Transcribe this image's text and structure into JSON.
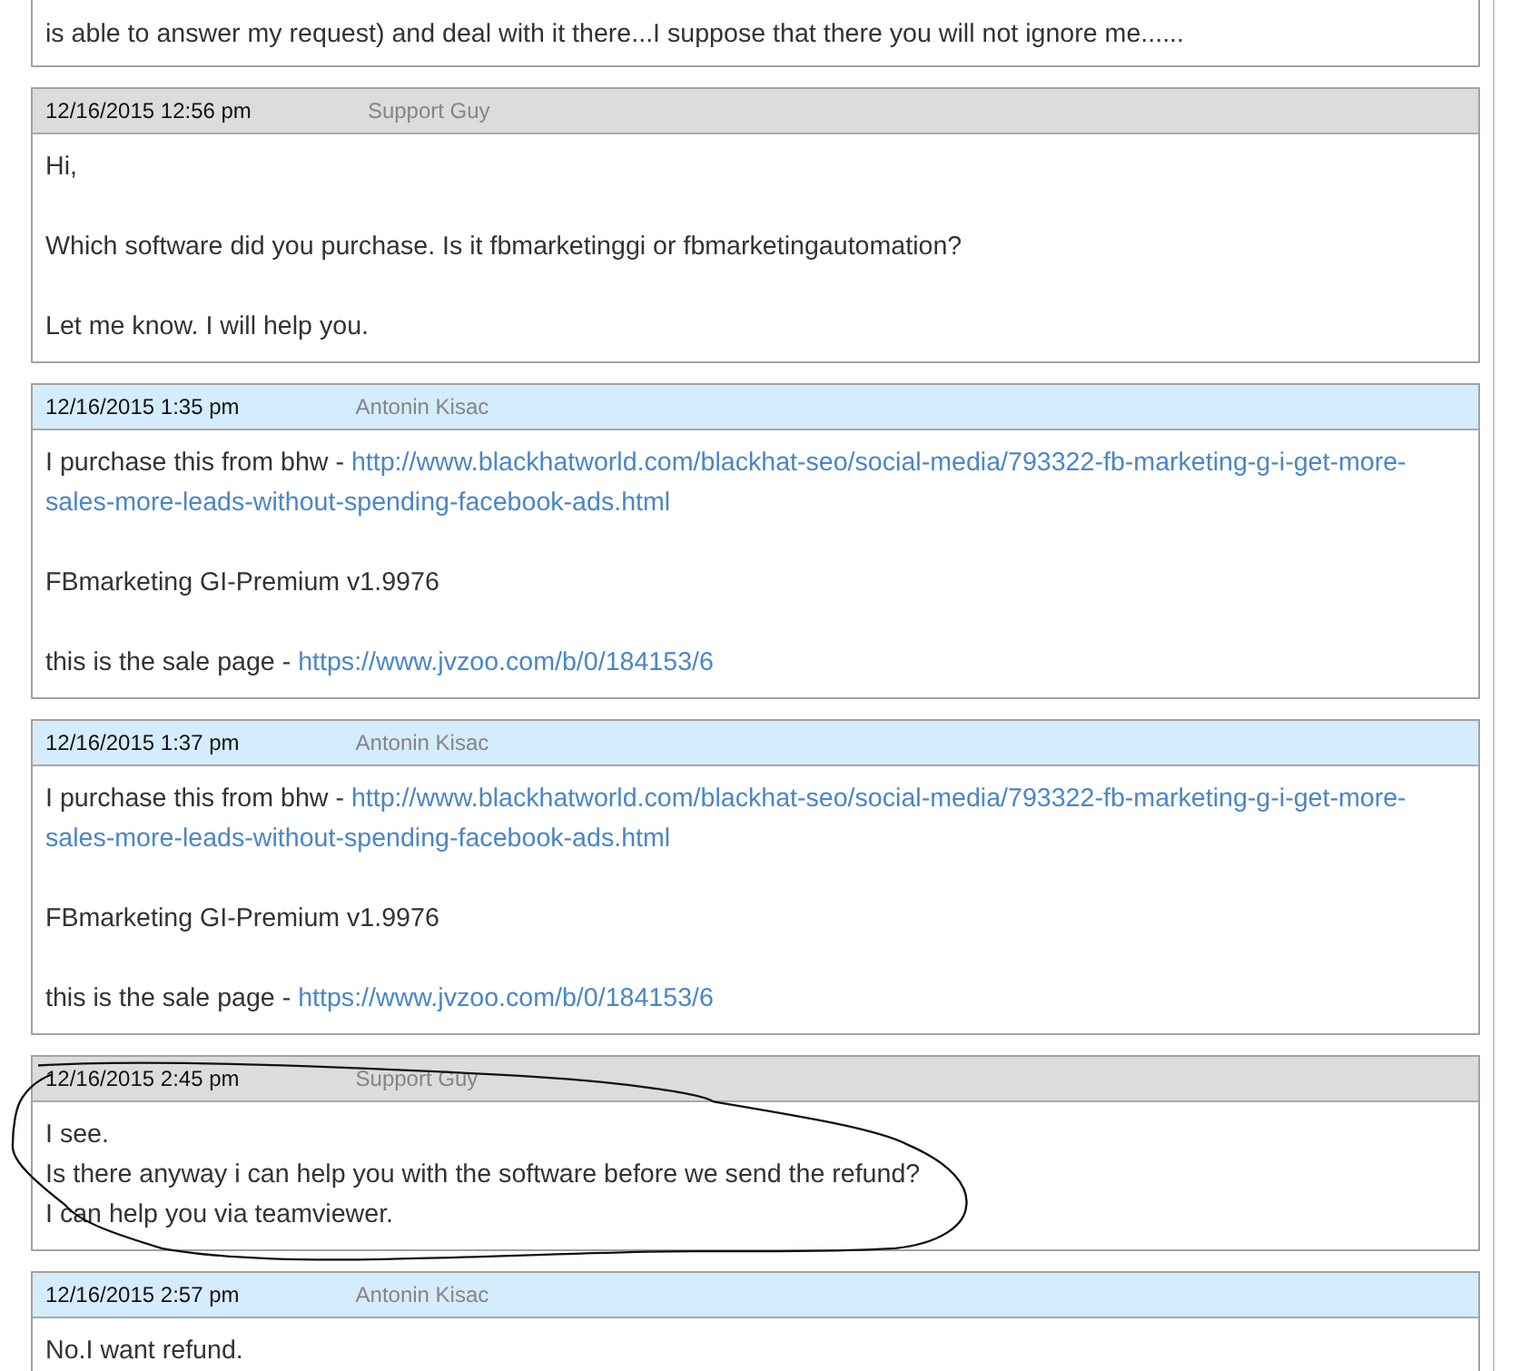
{
  "messages": [
    {
      "circled": false,
      "paragraphs": [
        {
          "lines": [
            {
              "text": "is able to answer my request) and deal with it there...I suppose that there you will not ignore me......"
            }
          ]
        }
      ]
    },
    {
      "kind": "staff",
      "date": "12/16/2015 12:56 pm",
      "author": "Support Guy",
      "circled": false,
      "paragraphs": [
        {
          "lines": [
            {
              "text": "Hi,"
            }
          ]
        },
        {
          "lines": [
            {
              "text": "Which software did you purchase. Is it fbmarketinggi or fbmarketingautomation?"
            }
          ]
        },
        {
          "lines": [
            {
              "text": "Let me know. I will help you."
            }
          ]
        }
      ]
    },
    {
      "kind": "customer",
      "date": "12/16/2015 1:35 pm",
      "author": "Antonin Kisac",
      "circled": false,
      "paragraphs": [
        {
          "lines": [
            {
              "text": "I purchase this from bhw - ",
              "link": "http://www.blackhatworld.com/blackhat-seo/social-media/793322-fb-marketing-g-i-get-more-"
            },
            {
              "link": "sales-more-leads-without-spending-facebook-ads.html"
            }
          ]
        },
        {
          "lines": [
            {
              "text": "FBmarketing GI-Premium v1.9976"
            }
          ]
        },
        {
          "lines": [
            {
              "text": "this is the sale page - ",
              "link": "https://www.jvzoo.com/b/0/184153/6"
            }
          ]
        }
      ]
    },
    {
      "kind": "customer",
      "date": "12/16/2015 1:37 pm",
      "author": "Antonin Kisac",
      "circled": false,
      "paragraphs": [
        {
          "lines": [
            {
              "text": "I purchase this from bhw - ",
              "link": "http://www.blackhatworld.com/blackhat-seo/social-media/793322-fb-marketing-g-i-get-more-"
            },
            {
              "link": "sales-more-leads-without-spending-facebook-ads.html"
            }
          ]
        },
        {
          "lines": [
            {
              "text": "FBmarketing GI-Premium v1.9976"
            }
          ]
        },
        {
          "lines": [
            {
              "text": "this is the sale page - ",
              "link": "https://www.jvzoo.com/b/0/184153/6"
            }
          ]
        }
      ]
    },
    {
      "kind": "staff",
      "date": "12/16/2015 2:45 pm",
      "author": "Support Guy",
      "circled": true,
      "paragraphs": [
        {
          "lines": [
            {
              "text": "I see."
            },
            {
              "text": "Is there anyway i can help you with the software before we send the refund?"
            },
            {
              "text": "I can help you via teamviewer."
            }
          ]
        }
      ]
    },
    {
      "kind": "customer",
      "date": "12/16/2015 2:57 pm",
      "author": "Antonin Kisac",
      "circled": false,
      "paragraphs": [
        {
          "lines": [
            {
              "text": "No.I want refund."
            }
          ]
        }
      ]
    }
  ]
}
